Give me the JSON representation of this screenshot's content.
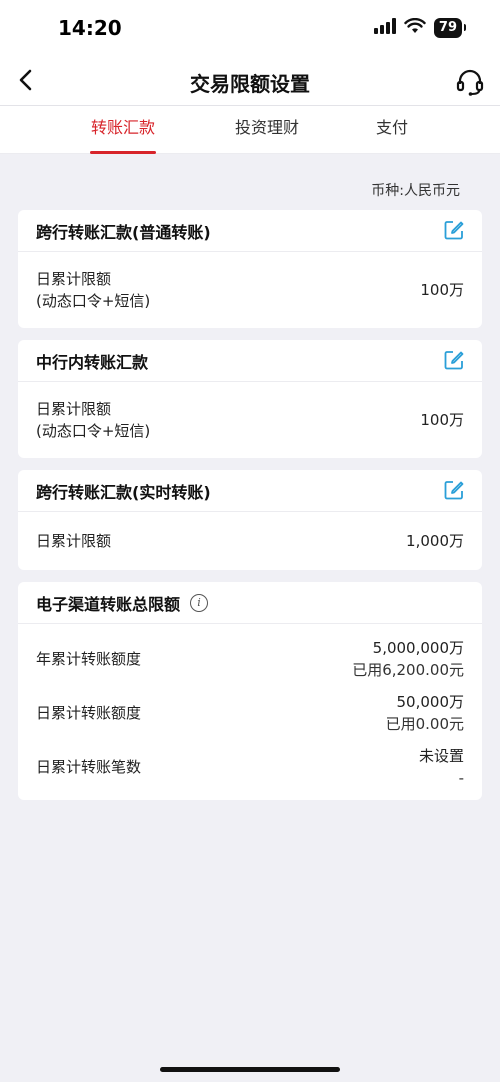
{
  "status": {
    "time": "14:20",
    "battery": "79"
  },
  "nav": {
    "title": "交易限额设置"
  },
  "tabs": [
    {
      "label": "转账汇款",
      "active": true
    },
    {
      "label": "投资理财",
      "active": false
    },
    {
      "label": "支付",
      "active": false
    }
  ],
  "currency": "币种:人民币元",
  "cards": {
    "interbank_normal": {
      "title": "跨行转账汇款(普通转账)",
      "label_line1": "日累计限额",
      "label_line2": "(动态口令+短信)",
      "value": "100万"
    },
    "intrabank": {
      "title": "中行内转账汇款",
      "label_line1": "日累计限额",
      "label_line2": "(动态口令+短信)",
      "value": "100万"
    },
    "interbank_realtime": {
      "title": "跨行转账汇款(实时转账)",
      "label": "日累计限额",
      "value": "1,000万"
    },
    "electronic": {
      "title": "电子渠道转账总限额",
      "rows": [
        {
          "label": "年累计转账额度",
          "value": "5,000,000万",
          "sub": "已用6,200.00元"
        },
        {
          "label": "日累计转账额度",
          "value": "50,000万",
          "sub": "已用0.00元"
        },
        {
          "label": "日累计转账笔数",
          "value": "未设置",
          "sub": "-"
        }
      ]
    }
  },
  "colors": {
    "accent": "#d7242a",
    "edit_icon": "#2a9fd8",
    "background": "#f0f0f5"
  }
}
